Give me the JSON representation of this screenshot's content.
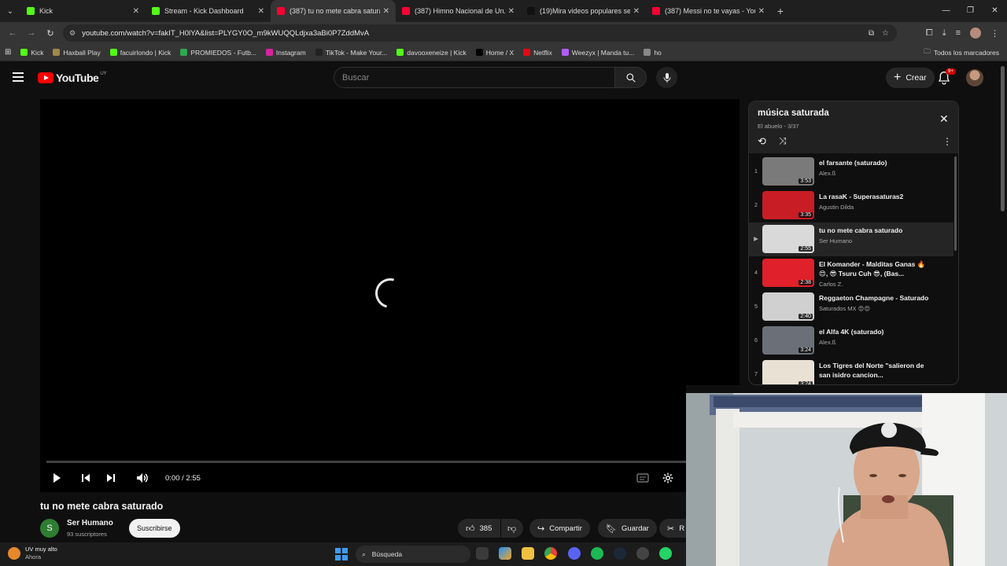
{
  "browser": {
    "tabs": [
      {
        "label": "Kick",
        "color": "#53fc18",
        "active": false
      },
      {
        "label": "Stream - Kick Dashboard",
        "color": "#53fc18",
        "active": false
      },
      {
        "label": "(387) tu no mete cabra saturad",
        "color": "#ff0033",
        "active": true
      },
      {
        "label": "(387) Himno Nacional de Urug",
        "color": "#ff0033",
        "active": false
      },
      {
        "label": "(19)Mira videos populares sele",
        "color": "#111111",
        "active": false
      },
      {
        "label": "(387) Messi no te vayas - YouTu",
        "color": "#ff0033",
        "active": false
      }
    ],
    "url": "youtube.com/watch?v=fakIT_H0lYA&list=PLYGY0O_m9kWUQQLdjxa3aBi0P7ZddMvA",
    "bookmarks": [
      {
        "label": "Kick",
        "color": "#53fc18"
      },
      {
        "label": "Haxball Play",
        "color": "#a08a4a"
      },
      {
        "label": "facuirlondo | Kick",
        "color": "#53fc18"
      },
      {
        "label": "PROMIEDOS - Futb...",
        "color": "#2fa84f"
      },
      {
        "label": "Instagram",
        "color": "#d6249f"
      },
      {
        "label": "TikTok - Make Your...",
        "color": "#222222"
      },
      {
        "label": "davooxeneize | Kick",
        "color": "#53fc18"
      },
      {
        "label": "Home / X",
        "color": "#000000"
      },
      {
        "label": "Netflix",
        "color": "#e50914"
      },
      {
        "label": "Weezyx | Manda tu...",
        "color": "#b15cff"
      },
      {
        "label": "ho",
        "color": "#888888"
      }
    ],
    "all_bookmarks": "Todos los marcadores"
  },
  "youtube": {
    "logo": "YouTube",
    "country": "UY",
    "search_placeholder": "Buscar",
    "create_label": "Crear",
    "notif_badge": "9+"
  },
  "player": {
    "time": "0:00 / 2:55",
    "progress_fraction": 0.0
  },
  "video": {
    "title": "tu no mete cabra saturado",
    "channel_initial": "S",
    "channel": "Ser Humano",
    "subscribers": "93 suscriptores",
    "subscribe": "Suscribirse",
    "likes": "385",
    "share": "Compartir",
    "save": "Guardar",
    "clip": "R"
  },
  "playlist": {
    "title": "música saturada",
    "subtitle": "El abuelo - 3/37",
    "items": [
      {
        "index": "1",
        "title": "el farsante (saturado)",
        "author": "Alex.ß",
        "duration": "3:53",
        "thumb": "#7a7a7a",
        "current": false
      },
      {
        "index": "2",
        "title": "La rasaK - Superasaturas2",
        "author": "Agustin Dilda",
        "duration": "3:35",
        "thumb": "#c81d25",
        "current": false
      },
      {
        "index": "▶",
        "title": "tu no mete cabra saturado",
        "author": "Ser Humano",
        "duration": "2:55",
        "thumb": "#d9d9d9",
        "current": true
      },
      {
        "index": "4",
        "title": "El Komander - Malditas Ganas 🔥😍, 😎 Tsuru Cuh 😎, (Bas...",
        "author": "Carlos Z.",
        "duration": "2:38",
        "thumb": "#e0202a",
        "current": false
      },
      {
        "index": "5",
        "title": "Reggaeton Champagne - Saturado",
        "author": "Saturados MX 😍😍",
        "duration": "2:40",
        "thumb": "#d0d0d0",
        "current": false
      },
      {
        "index": "6",
        "title": "el Alfa 4K (saturado)",
        "author": "Alex.ß",
        "duration": "3:24",
        "thumb": "#6b7078",
        "current": false
      },
      {
        "index": "7",
        "title": "Los Tigres del Norte \"salieron de san isidro cancion...",
        "author": "",
        "duration": "3:24",
        "thumb": "#e9e1d4",
        "current": false
      }
    ]
  },
  "taskbar": {
    "weather_title": "UV muy alto",
    "weather_sub": "Ahora",
    "search_label": "Búsqueda"
  },
  "colors": {
    "accent": "#ff0000",
    "background": "#0f0f0f",
    "panel": "#212121"
  }
}
